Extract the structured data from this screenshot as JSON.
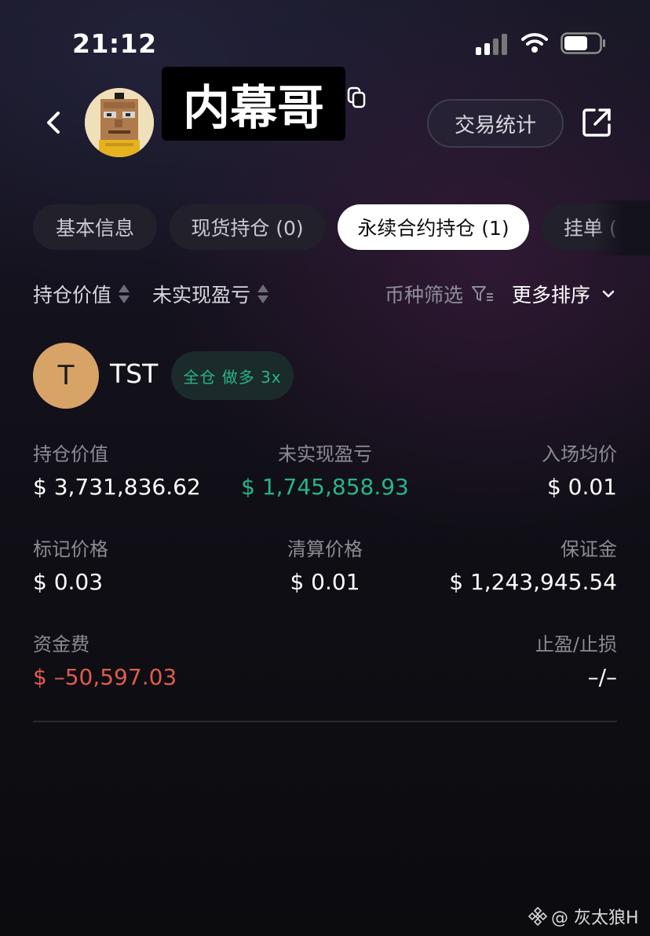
{
  "status_bar": {
    "time": "21:12"
  },
  "header": {
    "username": "内幕哥",
    "stats_button": "交易统计"
  },
  "tabs": [
    {
      "label": "基本信息",
      "active": false
    },
    {
      "label": "现货持仓 (0)",
      "active": false
    },
    {
      "label": "永续合约持仓 (1)",
      "active": true
    },
    {
      "label": "挂单 (",
      "active": false
    }
  ],
  "sort_bar": {
    "position_value": "持仓价值",
    "unrealized_pnl": "未实现盈亏",
    "coin_filter": "币种筛选",
    "more_sort": "更多排序"
  },
  "position": {
    "coin_letter": "T",
    "coin": "TST",
    "badge": "全仓 做多 3x",
    "fields": {
      "position_value": {
        "label": "持仓价值",
        "value": "$ 3,731,836.62"
      },
      "unrealized_pnl": {
        "label": "未实现盈亏",
        "value": "$ 1,745,858.93"
      },
      "entry_price": {
        "label": "入场均价",
        "value": "$ 0.01"
      },
      "mark_price": {
        "label": "标记价格",
        "value": "$ 0.03"
      },
      "liq_price": {
        "label": "清算价格",
        "value": "$ 0.01"
      },
      "margin": {
        "label": "保证金",
        "value": "$ 1,243,945.54"
      },
      "funding_fee": {
        "label": "资金费",
        "value": "$ –50,597.03"
      },
      "tp_sl": {
        "label": "止盈/止损",
        "value": "–/–"
      }
    }
  },
  "colors": {
    "positive": "#27b488",
    "negative": "#e05c4e",
    "coin_icon": "#d7a367"
  },
  "watermark": "@ 灰太狼H"
}
